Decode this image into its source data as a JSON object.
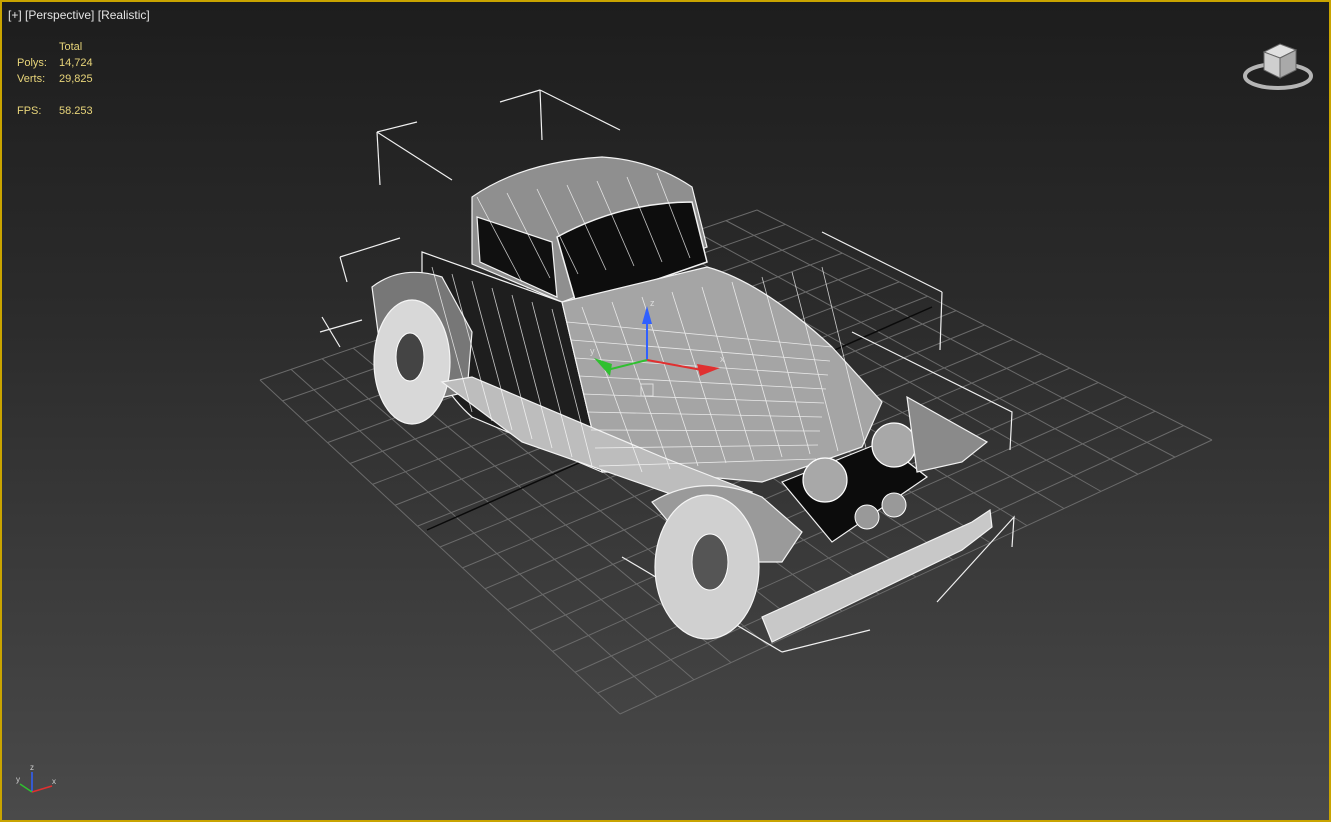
{
  "viewport": {
    "label": {
      "plus": "[+]",
      "view": "[Perspective]",
      "shading": "[Realistic]"
    }
  },
  "stats": {
    "header": "Total",
    "polys_label": "Polys:",
    "polys_value": "14,724",
    "verts_label": "Verts:",
    "verts_value": "29,825",
    "fps_label": "FPS:",
    "fps_value": "58.253"
  },
  "viewcube": {
    "icon": "viewcube-icon"
  },
  "gizmo": {
    "icon": "transform-gizmo-icon"
  },
  "axis_tripod": {
    "x": "x",
    "y": "y",
    "z": "z"
  },
  "colors": {
    "active_border": "#c9a400",
    "stats_text": "#e8d57a",
    "axis_x": "#e03030",
    "axis_y": "#30c030",
    "axis_z": "#3060ff"
  }
}
